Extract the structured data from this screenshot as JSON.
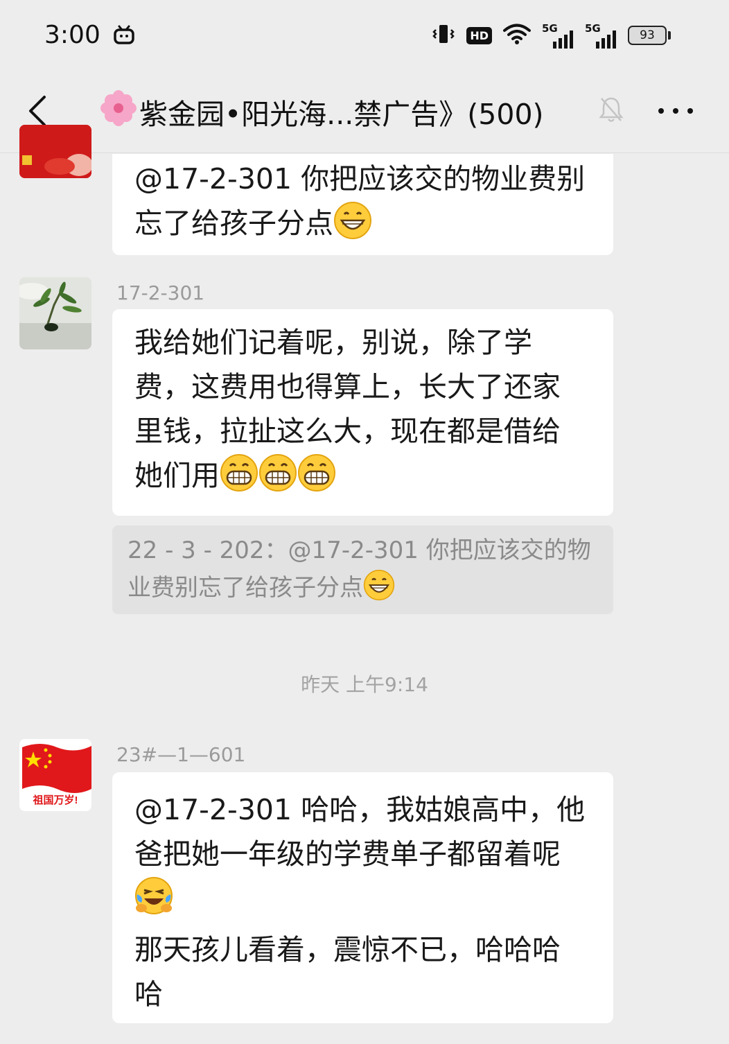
{
  "status_bar": {
    "time": "3:00",
    "hd_label": "HD",
    "signal_1": "5G",
    "signal_2": "5G",
    "battery": "93"
  },
  "header": {
    "title": "紫金园•阳光海...禁广告》(500)",
    "icons": [
      "back-chevron-icon",
      "flower-emoji-icon",
      "mute-bell-icon",
      "more-icon"
    ]
  },
  "messages": [
    {
      "sender": "",
      "text_line1": "@17-2-301 你把应该交的物业费别",
      "text_line2": "忘了给孩子分点",
      "emoji": "grin"
    },
    {
      "sender": "17-2-301",
      "lines": [
        "我给她们记着呢，别说，除了学",
        "费，这费用也得算上，长大了还家",
        "里钱，拉扯这么大，现在都是借给",
        "她们用"
      ],
      "emoji": "grimace",
      "quote_line1": "22 - 3 - 202：@17-2-301 你把应该交的物",
      "quote_line2": "业费别忘了给孩子分点"
    },
    {
      "sender": "23#—1—601",
      "lines": [
        "@17-2-301 哈哈，我姑娘高中，他",
        "爸把她一年级的学费单子都留着呢"
      ],
      "emoji": "laugh-cry",
      "lines_after": [
        "那天孩儿看着，震惊不已，哈哈哈",
        "哈"
      ],
      "avatar_text": "祖国万岁!"
    }
  ],
  "timestamp": "昨天 上午9:14"
}
